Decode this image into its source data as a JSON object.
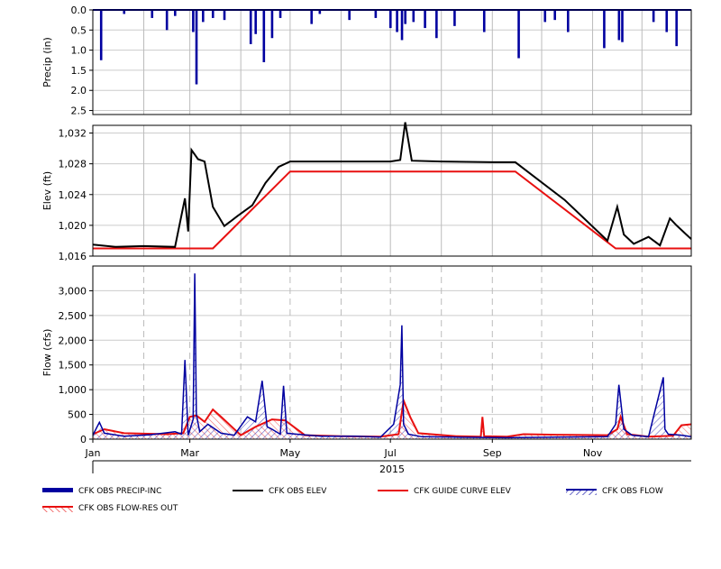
{
  "chart_data": [
    {
      "panel": "precip",
      "type": "bar",
      "ylabel": "Precip (in)",
      "inverted_y": true,
      "ylim": [
        0,
        2.6
      ],
      "yticks": [
        "0.0",
        "0.5",
        "1.0",
        "1.5",
        "2.0",
        "2.5"
      ],
      "ytick_values": [
        0,
        0.5,
        1.0,
        1.5,
        2.0,
        2.5
      ],
      "series": [
        {
          "name": "CFK OBS PRECIP-INC",
          "color": "#0000A0",
          "x": [
            "2015-01-06",
            "2015-01-20",
            "2015-02-06",
            "2015-02-15",
            "2015-02-20",
            "2015-03-03",
            "2015-03-05",
            "2015-03-09",
            "2015-03-15",
            "2015-03-22",
            "2015-04-07",
            "2015-04-10",
            "2015-04-15",
            "2015-04-20",
            "2015-04-25",
            "2015-05-14",
            "2015-05-19",
            "2015-06-06",
            "2015-06-22",
            "2015-07-01",
            "2015-07-05",
            "2015-07-08",
            "2015-07-10",
            "2015-07-15",
            "2015-07-22",
            "2015-07-29",
            "2015-08-09",
            "2015-08-27",
            "2015-09-17",
            "2015-10-03",
            "2015-10-09",
            "2015-10-17",
            "2015-11-08",
            "2015-11-17",
            "2015-11-19",
            "2015-12-08",
            "2015-12-16",
            "2015-12-22"
          ],
          "values": [
            1.25,
            0.1,
            0.2,
            0.5,
            0.15,
            0.55,
            1.85,
            0.3,
            0.2,
            0.25,
            0.85,
            0.6,
            1.3,
            0.7,
            0.2,
            0.35,
            0.1,
            0.25,
            0.2,
            0.45,
            0.55,
            0.75,
            0.35,
            0.3,
            0.45,
            0.7,
            0.4,
            0.55,
            1.2,
            0.3,
            0.25,
            0.55,
            0.95,
            0.75,
            0.8,
            0.3,
            0.55,
            0.9
          ]
        }
      ]
    },
    {
      "panel": "elevation",
      "type": "line",
      "ylabel": "Elev (ft)",
      "ylim": [
        1016,
        1033
      ],
      "yticks": [
        "1,016",
        "1,020",
        "1,024",
        "1,028",
        "1,032"
      ],
      "ytick_values": [
        1016,
        1020,
        1024,
        1028,
        1032
      ],
      "series": [
        {
          "name": "CFK OBS ELEV",
          "color": "#000000",
          "x": [
            "2015-01-01",
            "2015-01-15",
            "2015-02-01",
            "2015-02-20",
            "2015-02-26",
            "2015-02-28",
            "2015-03-02",
            "2015-03-06",
            "2015-03-10",
            "2015-03-15",
            "2015-03-22",
            "2015-03-30",
            "2015-04-08",
            "2015-04-16",
            "2015-04-24",
            "2015-05-01",
            "2015-06-01",
            "2015-07-01",
            "2015-07-07",
            "2015-07-10",
            "2015-07-14",
            "2015-08-01",
            "2015-09-01",
            "2015-09-15",
            "2015-10-15",
            "2015-11-10",
            "2015-11-16",
            "2015-11-20",
            "2015-11-26",
            "2015-12-05",
            "2015-12-12",
            "2015-12-18",
            "2015-12-22",
            "2015-12-31"
          ],
          "values": [
            1017.5,
            1017.2,
            1017.3,
            1017.2,
            1023.5,
            1019.2,
            1029.8,
            1028.6,
            1028.3,
            1022.4,
            1019.9,
            1021.2,
            1022.6,
            1025.5,
            1027.6,
            1028.3,
            1028.3,
            1028.3,
            1028.5,
            1033.4,
            1028.4,
            1028.3,
            1028.2,
            1028.2,
            1023.3,
            1018.0,
            1022.4,
            1018.8,
            1017.6,
            1018.5,
            1017.4,
            1020.9,
            1020.0,
            1018.2
          ]
        },
        {
          "name": "CFK GUIDE CURVE ELEV",
          "color": "#E81010",
          "x": [
            "2015-01-01",
            "2015-03-15",
            "2015-05-01",
            "2015-09-15",
            "2015-11-15",
            "2015-12-31"
          ],
          "values": [
            1017.0,
            1017.0,
            1027.0,
            1027.0,
            1017.0,
            1017.0
          ]
        }
      ]
    },
    {
      "panel": "flow",
      "type": "line",
      "ylabel": "Flow (cfs)",
      "ylim": [
        0,
        3500
      ],
      "yticks": [
        "0",
        "500",
        "1,000",
        "1,500",
        "2,000",
        "2,500",
        "3,000"
      ],
      "ytick_values": [
        0,
        500,
        1000,
        1500,
        2000,
        2500,
        3000
      ],
      "xticks": [
        "Jan",
        "Mar",
        "May",
        "Jul",
        "Sep",
        "Nov"
      ],
      "xtick_dates": [
        "2015-01-01",
        "2015-03-01",
        "2015-05-01",
        "2015-07-01",
        "2015-09-01",
        "2015-11-01"
      ],
      "year_label": "2015",
      "series": [
        {
          "name": "CFK OBS FLOW",
          "color": "#0000A0",
          "x": [
            "2015-01-01",
            "2015-01-05",
            "2015-01-08",
            "2015-01-20",
            "2015-02-05",
            "2015-02-20",
            "2015-02-24",
            "2015-02-26",
            "2015-02-28",
            "2015-03-03",
            "2015-03-04",
            "2015-03-05",
            "2015-03-07",
            "2015-03-12",
            "2015-03-20",
            "2015-03-28",
            "2015-04-05",
            "2015-04-10",
            "2015-04-14",
            "2015-04-17",
            "2015-04-20",
            "2015-04-25",
            "2015-04-27",
            "2015-04-29",
            "2015-05-05",
            "2015-05-20",
            "2015-06-10",
            "2015-06-25",
            "2015-07-03",
            "2015-07-07",
            "2015-07-08",
            "2015-07-09",
            "2015-07-12",
            "2015-07-20",
            "2015-08-10",
            "2015-09-10",
            "2015-10-10",
            "2015-11-10",
            "2015-11-15",
            "2015-11-17",
            "2015-11-20",
            "2015-11-25",
            "2015-12-05",
            "2015-12-14",
            "2015-12-15",
            "2015-12-17",
            "2015-12-25",
            "2015-12-31"
          ],
          "values": [
            80,
            340,
            120,
            60,
            90,
            150,
            100,
            1600,
            80,
            400,
            3350,
            500,
            150,
            300,
            120,
            80,
            450,
            350,
            1180,
            250,
            200,
            100,
            1080,
            120,
            100,
            60,
            60,
            40,
            300,
            1100,
            2300,
            300,
            100,
            50,
            40,
            30,
            40,
            50,
            300,
            1100,
            200,
            80,
            50,
            1250,
            200,
            100,
            80,
            50
          ]
        },
        {
          "name": "CFK OBS FLOW-RES OUT",
          "color": "#E81010",
          "x": [
            "2015-01-01",
            "2015-01-08",
            "2015-01-20",
            "2015-02-15",
            "2015-02-25",
            "2015-03-01",
            "2015-03-05",
            "2015-03-10",
            "2015-03-15",
            "2015-03-20",
            "2015-04-01",
            "2015-04-10",
            "2015-04-20",
            "2015-04-28",
            "2015-05-10",
            "2015-06-01",
            "2015-06-25",
            "2015-07-06",
            "2015-07-09",
            "2015-07-13",
            "2015-07-18",
            "2015-08-10",
            "2015-08-25",
            "2015-08-26",
            "2015-08-27",
            "2015-09-10",
            "2015-09-20",
            "2015-10-10",
            "2015-11-10",
            "2015-11-16",
            "2015-11-18",
            "2015-11-22",
            "2015-12-05",
            "2015-12-20",
            "2015-12-25",
            "2015-12-31"
          ],
          "values": [
            100,
            200,
            120,
            100,
            120,
            450,
            480,
            350,
            600,
            450,
            80,
            250,
            400,
            380,
            80,
            60,
            50,
            100,
            780,
            450,
            120,
            60,
            50,
            450,
            60,
            50,
            100,
            90,
            80,
            200,
            450,
            100,
            50,
            70,
            280,
            300
          ]
        }
      ]
    }
  ],
  "legend": {
    "items": [
      {
        "label": "CFK OBS PRECIP-INC",
        "style": "thick-bar",
        "color": "#0000A0"
      },
      {
        "label": "CFK OBS ELEV",
        "style": "line",
        "color": "#000000"
      },
      {
        "label": "CFK GUIDE CURVE ELEV",
        "style": "line",
        "color": "#E81010"
      },
      {
        "label": "CFK OBS FLOW",
        "style": "hatched",
        "color": "#0000A0"
      },
      {
        "label": "CFK OBS FLOW-RES OUT",
        "style": "hatched",
        "color": "#E81010"
      }
    ]
  }
}
